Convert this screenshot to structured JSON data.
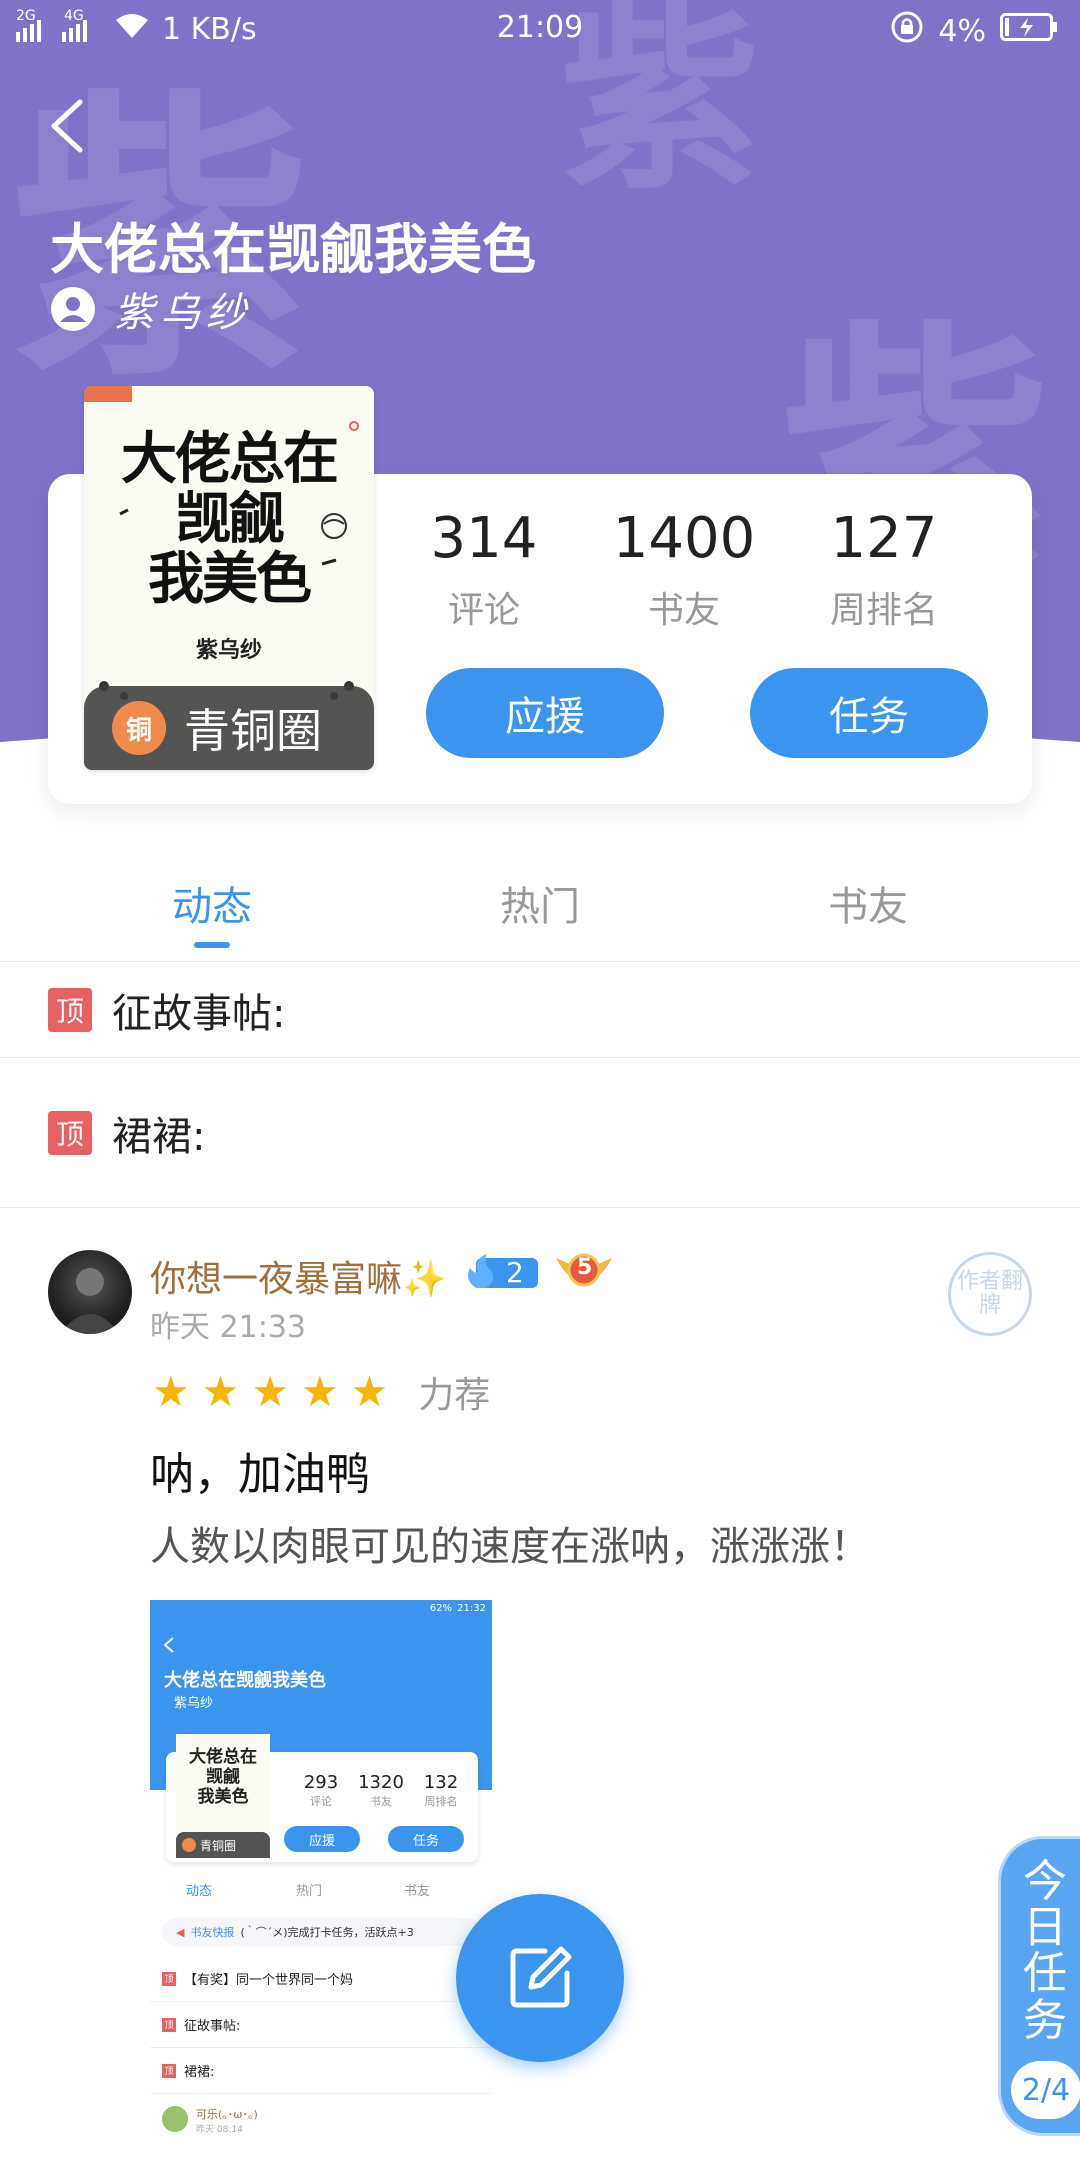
{
  "status_bar": {
    "network_1": "2G",
    "network_2": "4G",
    "speed": "1 KB/s",
    "time": "21:09",
    "battery": "4%"
  },
  "header": {
    "book_title": "大佬总在觊觎我美色",
    "author": "紫乌纱",
    "watermark_char": "紫"
  },
  "cover": {
    "title_line1": "大佬总在",
    "title_line2": "觊觎",
    "title_line3": "我美色",
    "author": "紫乌纱",
    "tier_badge": "铜",
    "tier_label": "青铜圈"
  },
  "stats": [
    {
      "value": "314",
      "label": "评论"
    },
    {
      "value": "1400",
      "label": "书友"
    },
    {
      "value": "127",
      "label": "周排名"
    }
  ],
  "buttons": {
    "support": "应援",
    "tasks": "任务"
  },
  "tabs": [
    "动态",
    "热门",
    "书友"
  ],
  "pinned": [
    {
      "tag": "顶",
      "text": "征故事帖:"
    },
    {
      "tag": "顶",
      "text": "裙裙:"
    }
  ],
  "post": {
    "username": "你想一夜暴富嘛✨",
    "level": "2",
    "medal": "5",
    "time": "昨天 21:33",
    "stamp": "作者翻牌",
    "rating_label": "力荐",
    "stars": 5,
    "title": "呐，加油鸭",
    "body": "人数以肉眼可见的速度在涨呐，涨涨涨！"
  },
  "embedded": {
    "status_time": "21:32",
    "status_battery": "62%",
    "title": "大佬总在觊觎我美色",
    "author": "紫乌纱",
    "stats": [
      {
        "value": "293",
        "label": "评论"
      },
      {
        "value": "1320",
        "label": "书友"
      },
      {
        "value": "132",
        "label": "周排名"
      }
    ],
    "tier_label": "青铜圈",
    "support": "应援",
    "tasks": "任务",
    "tabs": [
      "动态",
      "热门",
      "书友"
    ],
    "notice_tag": "书友快报",
    "notice_text": "(｀⌒´メ)完成打卡任务，活跃点+3",
    "rows": [
      "【有奖】同一个世界同一个妈",
      "征故事帖:",
      "裙裙:"
    ],
    "user": "可乐(｡･ω･｡)",
    "user_time": "昨天 08:14"
  },
  "floating": {
    "task_text": "今日任务",
    "task_count": "2/4"
  },
  "colors": {
    "header_purple": "#7e73c9",
    "accent_blue": "#3b95ee",
    "pin_red": "#e86060",
    "star_gold": "#f7b500"
  }
}
